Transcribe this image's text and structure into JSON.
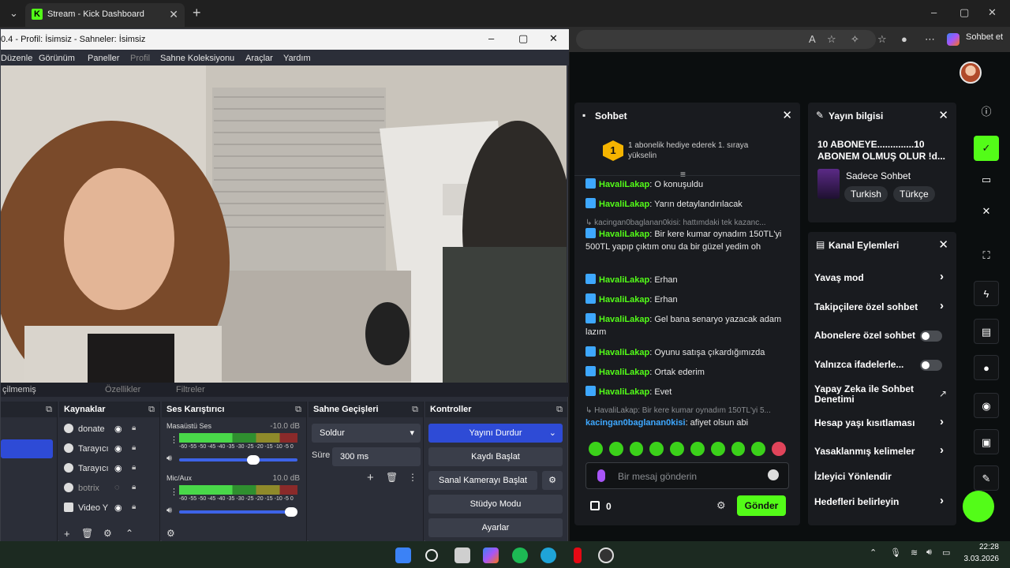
{
  "browser": {
    "tab_title": "Stream - Kick Dashboard",
    "tab_favicon_letter": "K",
    "sohbet_label": "Sohbet et",
    "accent": "#53fc18"
  },
  "obs": {
    "window_title": "0.4 - Profil: İsimsiz - Sahneler: İsimsiz",
    "menu": [
      "Düzenle",
      "Görünüm",
      "Paneller",
      "Profil",
      "Sahne Koleksiyonu",
      "Araçlar",
      "Yardım"
    ],
    "preview_bar": {
      "status": "çilmemiş",
      "properties": "Özellikler",
      "filters": "Filtreler"
    },
    "sources": {
      "title": "Kaynaklar",
      "items": [
        "donate",
        "Tarayıcı",
        "Tarayıcı",
        "botrix",
        "Video Y"
      ]
    },
    "mixer": {
      "title": "Ses Karıştırıcı",
      "channels": [
        {
          "name": "Masaüstü Ses",
          "db": "-10.0 dB"
        },
        {
          "name": "Mic/Aux",
          "db": "10.0 dB"
        }
      ],
      "scale": "-60 -55 -50 -45 -40 -35 -30 -25 -20 -15 -10  -5  0"
    },
    "transitions": {
      "title": "Sahne Geçişleri",
      "selected": "Soldur",
      "duration_label": "Süre",
      "duration_value": "300 ms"
    },
    "controls": {
      "title": "Kontroller",
      "buttons": [
        "Yayını Durdur",
        "Kaydı Başlat",
        "Sanal Kamerayı Başlat",
        "Stüdyo Modu",
        "Ayarlar"
      ]
    }
  },
  "chat": {
    "title": "Sohbet",
    "gift_rank": "1",
    "gift_text": "1 abonelik hediye ederek 1. sıraya yükselin",
    "messages": [
      {
        "user": "HavaliLakap",
        "text": ": O konuşuldu"
      },
      {
        "user": "HavaliLakap",
        "text": ": Yarın detaylandırılacak"
      },
      {
        "reply": "kacingan0baglanan0kisi: hattımdaki tek kazanc..."
      },
      {
        "user": "HavaliLakap",
        "text": ": Bir kere kumar oynadım 150TL'yi 500TL yapıp çıktım onu da bir güzel yedim oh"
      },
      {
        "user": "HavaliLakap",
        "text": ": Erhan"
      },
      {
        "user": "HavaliLakap",
        "text": ": Erhan"
      },
      {
        "user": "HavaliLakap",
        "text": ": Gel bana senaryo yazacak adam lazım"
      },
      {
        "user": "HavaliLakap",
        "text": ": Oyunu satışa çıkardığımızda"
      },
      {
        "user": "HavaliLakap",
        "text": ": Ortak ederim"
      },
      {
        "user": "HavaliLakap",
        "text": ": Evet"
      },
      {
        "reply": "HavaliLakap: Bir kere kumar oynadım 150TL'yi 5..."
      },
      {
        "user2": "kacingan0baglanan0kisi",
        "text": ": afiyet olsun abi"
      }
    ],
    "input_placeholder": "Bir mesaj gönderin",
    "points": "0",
    "send_label": "Gönder"
  },
  "stream_info": {
    "title": "Yayın bilgisi",
    "stream_title": "10 ABONEYE..............10 ABONEM OLMUŞ OLUR !d...",
    "category": "Sadece Sohbet",
    "tags": [
      "Turkish",
      "Türkçe"
    ]
  },
  "channel_actions": {
    "title": "Kanal Eylemleri",
    "items": [
      {
        "label": "Yavaş mod",
        "control": "chevron"
      },
      {
        "label": "Takipçilere özel sohbet",
        "control": "chevron"
      },
      {
        "label": "Abonelere özel sohbet",
        "control": "toggle"
      },
      {
        "label": "Yalnızca ifadelerle...",
        "control": "toggle"
      },
      {
        "label": "Yapay Zeka ile Sohbet Denetimi",
        "control": "external"
      },
      {
        "label": "Hesap yaşı kısıtlaması",
        "control": "chevron"
      },
      {
        "label": "Yasaklanmış kelimeler",
        "control": "chevron"
      },
      {
        "label": "İzleyici Yönlendir",
        "control": "none"
      },
      {
        "label": "Hedefleri belirleyin",
        "control": "chevron"
      }
    ]
  },
  "taskbar": {
    "time": "22:28",
    "date": "3.03.2026"
  }
}
